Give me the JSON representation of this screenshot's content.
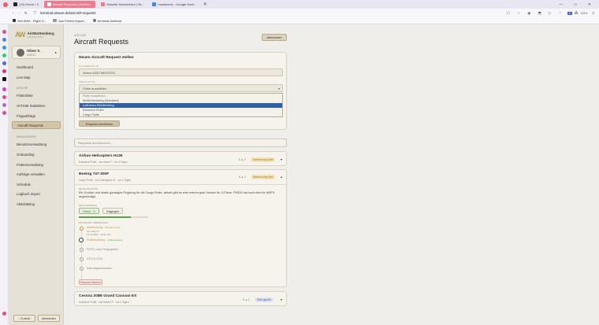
{
  "browser": {
    "tabs": [
      {
        "label": "(19) Home / X",
        "color": "#222"
      },
      {
        "label": "Aircraft Requests | AirWürt...",
        "color": "#fff",
        "active": true
      },
      {
        "label": "Aktuelle Nachrichten | Br...",
        "color": "#ee7b8c"
      },
      {
        "label": "mantisnetz - Google Such...",
        "color": "#4285f4"
      }
    ],
    "url": "terminal.airwue.de/aircraft-requests",
    "zoom": "110%",
    "bookmarks": [
      "Sim Brief - Flight O...",
      "Aus Firefox import...",
      "terminal-frontend"
    ]
  },
  "sidebar": {
    "logo_main": "AirWürttemberg",
    "logo_sub": "TERMINAL",
    "user_name": "Oliver S.",
    "user_id": "AWE13",
    "top_items": [
      "Dashboard",
      "Live Map"
    ],
    "section_airline": "AIRLINE",
    "airline_items": [
      "Flottenliste",
      "VATSIM Statistiken",
      "Flugaufträge",
      "Aircraft Requests"
    ],
    "section_management": "MANAGEMENT",
    "management_items": [
      "Benutzerverwaltung",
      "Onboarding",
      "Flottenverwaltung",
      "Aufträge verwalten",
      "Schedule",
      "Logbuch Import",
      "Aktivitätslog"
    ],
    "back_label": "‹ Zurück",
    "logout_label": "Abmelden"
  },
  "page": {
    "overline": "AIRLINE",
    "title": "Aircraft Requests",
    "header_button": "Abbrechen",
    "form": {
      "title": "Neuen Aircraft Request stellen",
      "aircraft_label": "FLUGZEUGTYP",
      "aircraft_value": "Airbus A320 NEO/CEO",
      "fleet_label": "ZIELFLOTTE",
      "fleet_placeholder": "Flotte auswählen...",
      "options": [
        "Flotte auswählen...",
        "AirWürttemberg (Standard)",
        "Lufthansa Württemberg",
        "Exclusive Flotte",
        "Cargo Flotte"
      ],
      "selected_index": 2,
      "submit": "Request einreichen"
    },
    "search_placeholder": "Requests durchsuchen...",
    "requests": [
      {
        "name": "Airbus Helicopters H135",
        "meta": "Exklusive Flotte · von Hans P. · vor 4 Tagen",
        "votes": "5 ▲ 2",
        "status": "Abstimmung läuft"
      },
      {
        "name": "Boeing 747-200F",
        "meta": "Cargo Flotte · von Christopher B. · vor 4 Tagen",
        "votes": "6 ▲ 2",
        "status": "Abstimmung läuft",
        "desc_label": "BEGRÜNDUNG",
        "description": "Ein Großen und relativ günstiges Flugzeug für die Cargo Flotte, aktuell gibt es eine extrem gute Version für X-Plane. PMDG hat noch eine für MSFS angekündigt.",
        "vote_label": "ABSTIMMUNG",
        "vote_yes": "Dafür · 6",
        "vote_no": "Dagegen",
        "vote_fraction": 0.75,
        "progress_label": "PROZESS-ÜBERSICHT",
        "steps": [
          {
            "label": "Abstimmung",
            "sub": "· Aktuelle Phase",
            "note": "von Hans P.",
            "date": "21.11.2024 · 14:22 Uhr",
            "state": "done"
          },
          {
            "label": "Flottenprüfung",
            "sub": "· In Bearbeitung",
            "state": "active"
          },
          {
            "label": "FDTD Lead Freigegeben",
            "state": "todo"
          },
          {
            "label": "CEO & COO",
            "state": "todo"
          },
          {
            "label": "Kauf abgeschlossen",
            "state": "todo"
          }
        ],
        "delete_label": "Request löschen"
      },
      {
        "name": "Cessna 208B Grand Caravan EX",
        "meta": "Exklusive Flotte · von Marcel P. · vor 4 Tagen",
        "votes": "5 ▲ 1",
        "status": "Wird geprüft"
      }
    ]
  },
  "colors": {
    "accent": "#b89a55",
    "selected": "#2f5fa8",
    "brand_pink": "#ee7b8c"
  }
}
